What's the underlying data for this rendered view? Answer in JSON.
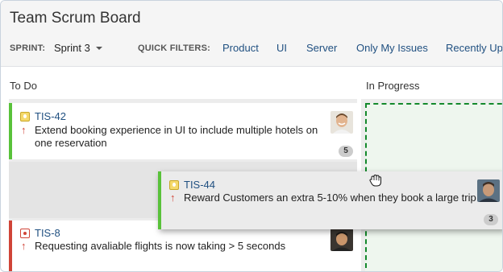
{
  "board": {
    "title": "Team Scrum Board"
  },
  "sprint": {
    "label": "SPRINT:",
    "value": "Sprint 3"
  },
  "quick_filters": {
    "label": "QUICK FILTERS:",
    "items": [
      "Product",
      "UI",
      "Server",
      "Only My Issues",
      "Recently Upd"
    ]
  },
  "columns": {
    "todo": "To Do",
    "in_progress": "In Progress"
  },
  "cards": [
    {
      "key": "TIS-42",
      "type": "story",
      "priority": "↑",
      "summary_line1": "Extend booking experience in UI to include multiple hotels on",
      "summary_line2": "one reservation",
      "estimate": "5"
    },
    {
      "key": "TIS-44",
      "type": "story",
      "priority": "↑",
      "summary_line1": "Reward Customers an extra 5-10% when they book a large trip",
      "estimate": "3",
      "state": "dragging"
    },
    {
      "key": "TIS-8",
      "type": "bug",
      "priority": "↑",
      "summary_line1": "Requesting avaliable flights is now taking > 5 seconds"
    }
  ],
  "colors": {
    "story_border": "#59c23a",
    "bug_border": "#d04437",
    "link": "#205081",
    "dropzone": "#14892c"
  },
  "icons": [
    "story-icon",
    "bug-icon",
    "priority-up-icon",
    "grab-hand-icon",
    "caret-down-icon"
  ]
}
